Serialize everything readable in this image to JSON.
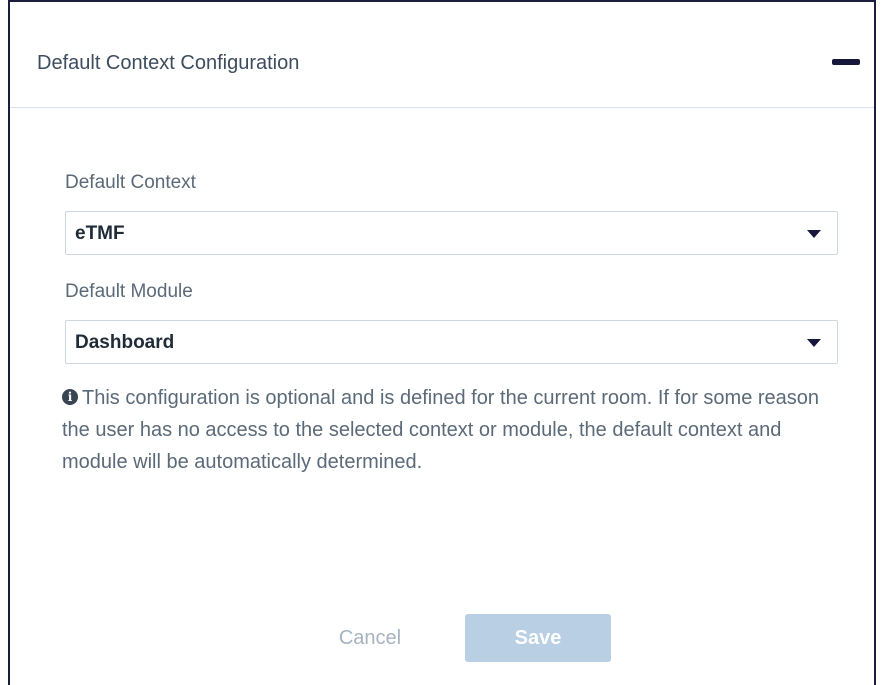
{
  "panel": {
    "title": "Default Context Configuration",
    "collapse_icon": "minus-icon"
  },
  "form": {
    "context": {
      "label": "Default Context",
      "selected": "eTMF"
    },
    "module": {
      "label": "Default Module",
      "selected": "Dashboard"
    },
    "info": {
      "icon": "info-circle-icon",
      "text": "This configuration is optional and is defined for the current room. If for some reason the user has no access to the selected context or module, the default context and module will be automatically determined."
    }
  },
  "actions": {
    "cancel_label": "Cancel",
    "save_label": "Save"
  },
  "colors": {
    "border": "#1a1d3d",
    "save_disabled": "#b8cfe4",
    "cancel_text": "#a6b3c1"
  }
}
